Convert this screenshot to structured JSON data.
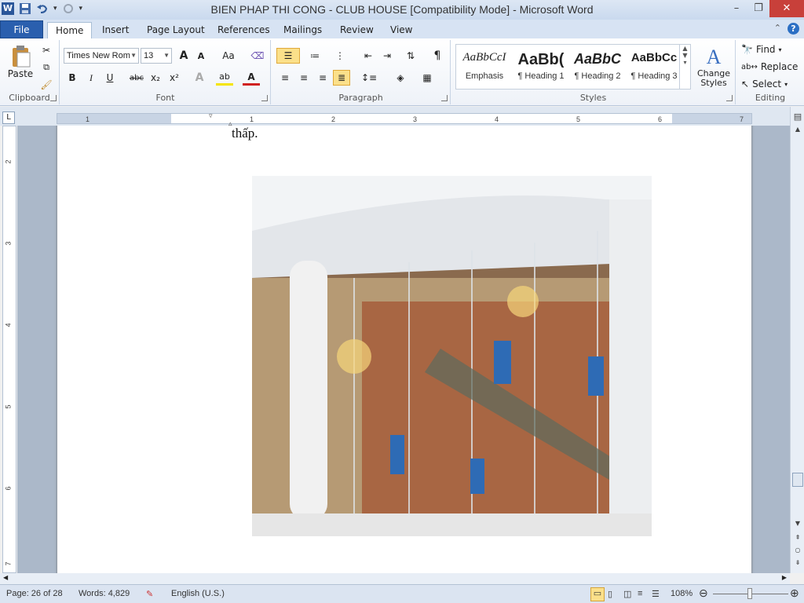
{
  "window": {
    "title": "BIEN PHAP THI CONG - CLUB HOUSE [Compatibility Mode]  -  Microsoft Word",
    "minimize": "–",
    "restore": "❐",
    "close": "✕"
  },
  "qat": {
    "app_icon": "W",
    "undo_dropdown": "▾",
    "customize": "▾"
  },
  "tabs": [
    {
      "label": "File"
    },
    {
      "label": "Home"
    },
    {
      "label": "Insert"
    },
    {
      "label": "Page Layout"
    },
    {
      "label": "References"
    },
    {
      "label": "Mailings"
    },
    {
      "label": "Review"
    },
    {
      "label": "View"
    }
  ],
  "ribbon": {
    "clipboard": {
      "label": "Clipboard",
      "paste": "Paste"
    },
    "font": {
      "label": "Font",
      "font_name": "Times New Rom",
      "font_size": "13",
      "bold": "B",
      "italic": "I",
      "underline": "U",
      "strike": "abc",
      "subscript": "x₂",
      "superscript": "x²",
      "grow": "A",
      "shrink": "A",
      "case": "Aa",
      "text_effects": "A",
      "highlight": "ab",
      "font_color": "A"
    },
    "paragraph": {
      "label": "Paragraph",
      "show_marks": "¶"
    },
    "styles": {
      "label": "Styles",
      "items": [
        {
          "preview": "AaBbCcI",
          "name": "Emphasis"
        },
        {
          "preview": "AaBb(",
          "name": "¶ Heading 1"
        },
        {
          "preview": "AaBbC",
          "name": "¶ Heading 2"
        },
        {
          "preview": "AaBbCc",
          "name": "¶ Heading 3"
        }
      ],
      "change_styles": "Change Styles"
    },
    "editing": {
      "label": "Editing",
      "find": "Find",
      "replace": "Replace",
      "select": "Select"
    }
  },
  "ruler": {
    "ticks": [
      "1",
      "1",
      "2",
      "3",
      "4",
      "5",
      "6",
      "7"
    ],
    "vticks": [
      "2",
      "3",
      "4",
      "5",
      "6",
      "7"
    ]
  },
  "document": {
    "text": "thấp."
  },
  "status": {
    "page": "Page: 26 of 28",
    "words": "Words: 4,829",
    "language": "English (U.S.)",
    "zoom": "108%"
  },
  "colors": {
    "accent": "#2b579a",
    "file_tab": "#2a5fae",
    "close": "#c8403a"
  }
}
